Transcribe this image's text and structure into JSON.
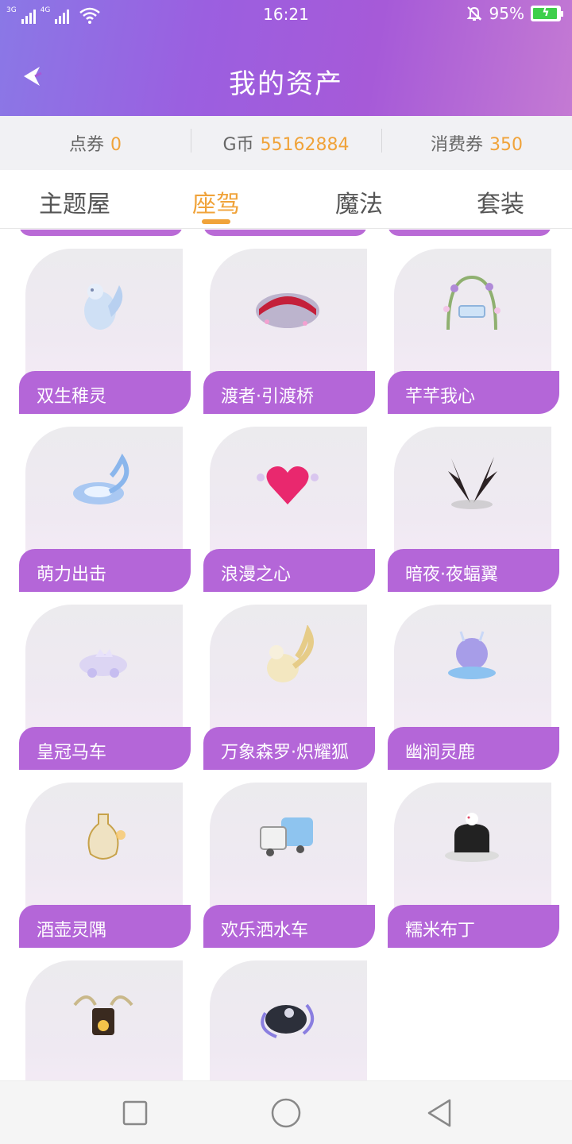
{
  "status_bar": {
    "network_left": "3G",
    "network_right": "4G",
    "time": "16:21",
    "battery_percent": "95%",
    "icons": [
      "signal-icon",
      "wifi-icon",
      "bell-off-icon",
      "battery-charging-icon"
    ]
  },
  "header": {
    "title": "我的资产",
    "back_icon": "back-arrow-icon",
    "gradient_colors": [
      "#8a78e6",
      "#a65ad8",
      "#c47ad3"
    ]
  },
  "balances": [
    {
      "label": "点券",
      "value": "0"
    },
    {
      "label": "G币",
      "value": "55162884"
    },
    {
      "label": "消费券",
      "value": "350"
    }
  ],
  "tabs": [
    {
      "label": "主题屋",
      "active": false
    },
    {
      "label": "座驾",
      "active": true
    },
    {
      "label": "魔法",
      "active": false
    },
    {
      "label": "套装",
      "active": false
    }
  ],
  "items": [
    {
      "name": "双生稚灵",
      "icon": "spirit-fox-icon"
    },
    {
      "name": "渡者·引渡桥",
      "icon": "red-bridge-icon"
    },
    {
      "name": "芊芊我心",
      "icon": "flower-swing-icon"
    },
    {
      "name": "萌力出击",
      "icon": "blue-whirl-icon"
    },
    {
      "name": "浪漫之心",
      "icon": "pink-heart-icon"
    },
    {
      "name": "暗夜·夜蝠翼",
      "icon": "bat-wings-icon"
    },
    {
      "name": "皇冠马车",
      "icon": "crown-carriage-icon"
    },
    {
      "name": "万象森罗·炽耀狐",
      "icon": "golden-fox-icon"
    },
    {
      "name": "幽涧灵鹿",
      "icon": "blue-deer-icon"
    },
    {
      "name": "酒壶灵隅",
      "icon": "wine-pot-icon"
    },
    {
      "name": "欢乐洒水车",
      "icon": "water-truck-icon"
    },
    {
      "name": "糯米布丁",
      "icon": "pudding-icon"
    },
    {
      "name": "",
      "icon": "golden-throne-icon"
    },
    {
      "name": "",
      "icon": "dark-swirl-icon"
    }
  ],
  "colors": {
    "accent": "#f0a33a",
    "label_bar": "#b466d8"
  },
  "navbar": {
    "icons": [
      "recent-apps-icon",
      "home-icon",
      "back-nav-icon"
    ]
  }
}
